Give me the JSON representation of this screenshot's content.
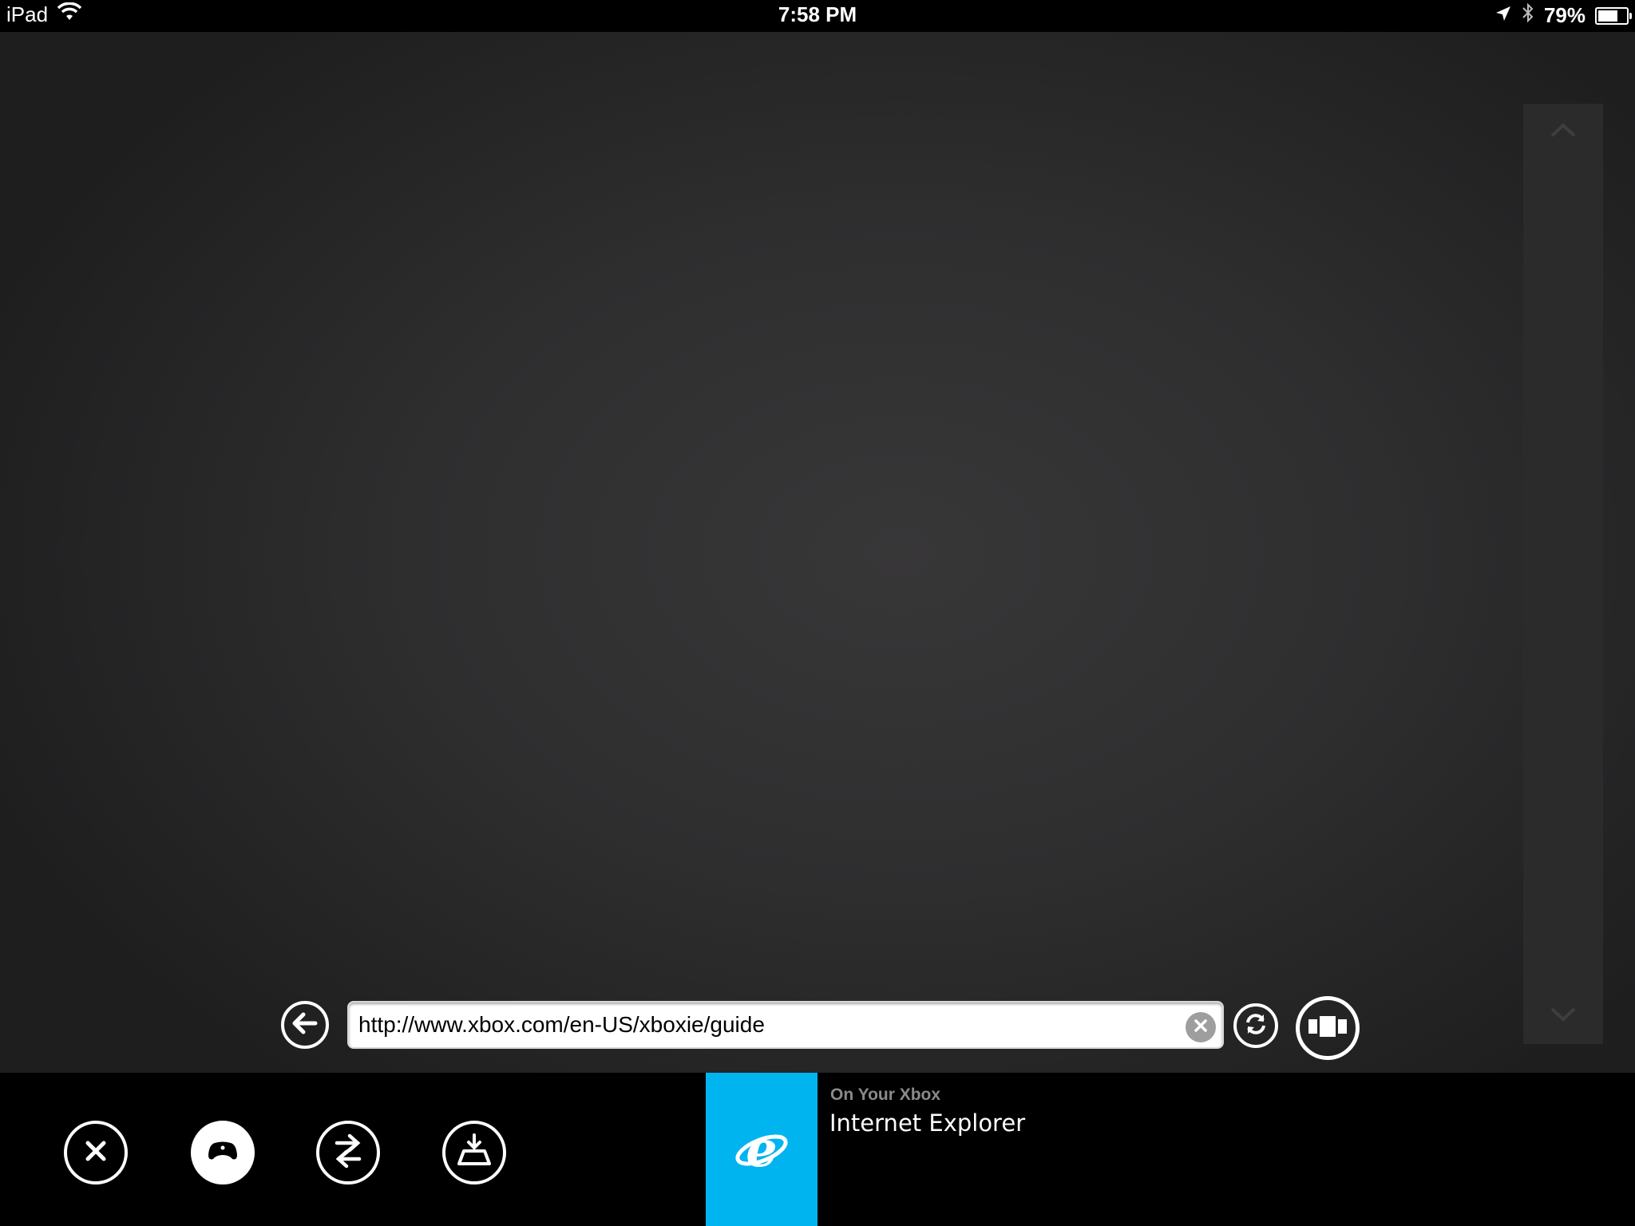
{
  "status_bar": {
    "device": "iPad",
    "time": "7:58 PM",
    "battery_percent": "79%",
    "battery_level": 0.79,
    "icons": [
      "wifi-icon",
      "location-arrow-icon",
      "bluetooth-icon",
      "battery-icon"
    ]
  },
  "browser": {
    "url": "http://www.xbox.com/en-US/xboxie/guide",
    "buttons": [
      "back-arrow-icon",
      "clear-icon",
      "refresh-icon",
      "tabs-icon"
    ]
  },
  "scroll": {
    "icons": [
      "chevron-up-icon",
      "chevron-down-icon"
    ]
  },
  "bottom_bar": {
    "buttons": [
      "close-icon",
      "controller-icon",
      "switch-icon",
      "eject-icon"
    ],
    "now_playing_label": "On Your Xbox",
    "now_playing_app": "Internet Explorer",
    "app_tile_color": "#00b4f0",
    "app_icon": "internet-explorer-icon"
  }
}
